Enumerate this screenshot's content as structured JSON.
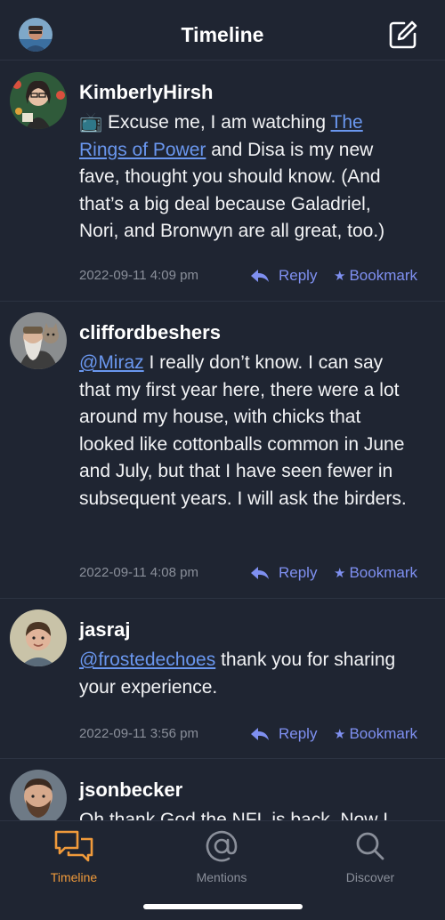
{
  "header": {
    "title": "Timeline",
    "avatar_icon": "user-avatar",
    "compose_icon": "compose-icon"
  },
  "posts": [
    {
      "username": "KimberlyHirsh",
      "text_before": "📺 Excuse me, I am watching ",
      "link": "The Rings of Power",
      "text_after": " and Disa is my new fave, thought you should know. (And that’s a big deal because Galadriel, Nori, and Bronwyn are all great, too.)",
      "date": "2022-09-11 4:09 pm",
      "reply_label": "Reply",
      "bookmark_label": "Bookmark"
    },
    {
      "username": "cliffordbeshers",
      "text_before": "",
      "link": "@Miraz",
      "text_after": " I really don’t know. I can say that my first year here, there were a lot around my house, with chicks that looked like cottonballs common in June and July, but that I have seen fewer in subsequent years. I will ask the birders.",
      "date": "2022-09-11 4:08 pm",
      "reply_label": "Reply",
      "bookmark_label": "Bookmark"
    },
    {
      "username": "jasraj",
      "text_before": "",
      "link": "@frostedechoes",
      "text_after": " thank you for sharing your experience.",
      "date": "2022-09-11 3:56 pm",
      "reply_label": "Reply",
      "bookmark_label": "Bookmark"
    },
    {
      "username": "jsonbecker",
      "text_before": "Oh thank God the NFL is back. Now I",
      "link": "",
      "text_after": "",
      "date": "",
      "reply_label": "",
      "bookmark_label": ""
    }
  ],
  "tabs": [
    {
      "label": "Timeline",
      "icon": "chat-bubbles-icon",
      "active": true
    },
    {
      "label": "Mentions",
      "icon": "at-sign-icon",
      "active": false
    },
    {
      "label": "Discover",
      "icon": "search-icon",
      "active": false
    }
  ],
  "colors": {
    "background": "#1f2532",
    "link": "#6a97ef",
    "action": "#7f90f1",
    "active_tab": "#f09a3b",
    "muted": "#8a8f9a"
  }
}
